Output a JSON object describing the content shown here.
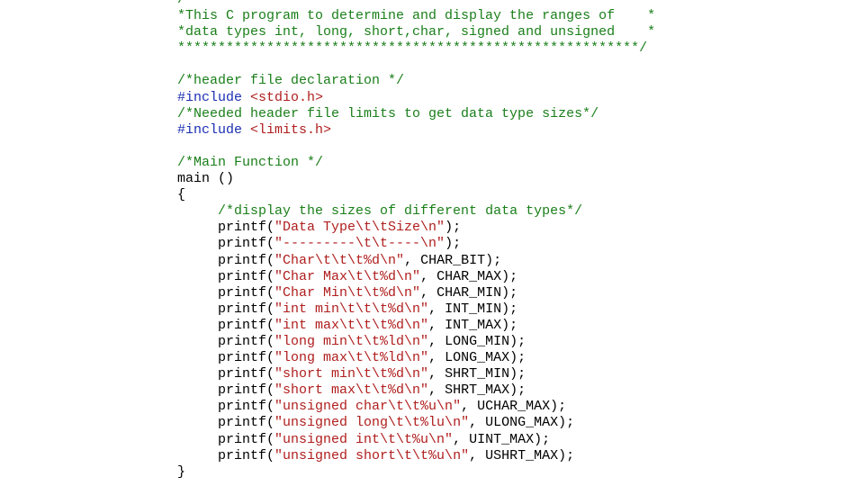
{
  "colors": {
    "background": "#ffffff",
    "comment": "#1a7f1a",
    "directive": "#1c2fb3",
    "string": "#b01e1e",
    "plain": "#000000"
  },
  "code_lines": [
    [
      {
        "t": "comment",
        "v": "/*******************************************************"
      }
    ],
    [
      {
        "t": "comment",
        "v": "*This C program to determine and display the ranges of    *"
      }
    ],
    [
      {
        "t": "comment",
        "v": "*data types int, long, short,char, signed and unsigned    *"
      }
    ],
    [
      {
        "t": "comment",
        "v": "*********************************************************/"
      }
    ],
    [],
    [
      {
        "t": "comment",
        "v": "/*header file declaration */"
      }
    ],
    [
      {
        "t": "directive",
        "v": "#include "
      },
      {
        "t": "header",
        "v": "<stdio.h>"
      }
    ],
    [
      {
        "t": "comment",
        "v": "/*Needed header file limits to get data type sizes*/"
      }
    ],
    [
      {
        "t": "directive",
        "v": "#include "
      },
      {
        "t": "header",
        "v": "<limits.h>"
      }
    ],
    [],
    [
      {
        "t": "comment",
        "v": "/*Main Function */"
      }
    ],
    [
      {
        "t": "plain",
        "v": "main ()"
      }
    ],
    [
      {
        "t": "plain",
        "v": "{"
      }
    ],
    [
      {
        "t": "plain",
        "v": "     "
      },
      {
        "t": "comment",
        "v": "/*display the sizes of different data types*/"
      }
    ],
    [
      {
        "t": "plain",
        "v": "     printf("
      },
      {
        "t": "string",
        "v": "\"Data Type\\t\\tSize\\n\""
      },
      {
        "t": "plain",
        "v": ");"
      }
    ],
    [
      {
        "t": "plain",
        "v": "     printf("
      },
      {
        "t": "string",
        "v": "\"---------\\t\\t----\\n\""
      },
      {
        "t": "plain",
        "v": ");"
      }
    ],
    [
      {
        "t": "plain",
        "v": "     printf("
      },
      {
        "t": "string",
        "v": "\"Char\\t\\t\\t%d\\n\""
      },
      {
        "t": "plain",
        "v": ", CHAR_BIT);"
      }
    ],
    [
      {
        "t": "plain",
        "v": "     printf("
      },
      {
        "t": "string",
        "v": "\"Char Max\\t\\t%d\\n\""
      },
      {
        "t": "plain",
        "v": ", CHAR_MAX);"
      }
    ],
    [
      {
        "t": "plain",
        "v": "     printf("
      },
      {
        "t": "string",
        "v": "\"Char Min\\t\\t%d\\n\""
      },
      {
        "t": "plain",
        "v": ", CHAR_MIN);"
      }
    ],
    [
      {
        "t": "plain",
        "v": "     printf("
      },
      {
        "t": "string",
        "v": "\"int min\\t\\t\\t%d\\n\""
      },
      {
        "t": "plain",
        "v": ", INT_MIN);"
      }
    ],
    [
      {
        "t": "plain",
        "v": "     printf("
      },
      {
        "t": "string",
        "v": "\"int max\\t\\t\\t%d\\n\""
      },
      {
        "t": "plain",
        "v": ", INT_MAX);"
      }
    ],
    [
      {
        "t": "plain",
        "v": "     printf("
      },
      {
        "t": "string",
        "v": "\"long min\\t\\t%ld\\n\""
      },
      {
        "t": "plain",
        "v": ", LONG_MIN);"
      }
    ],
    [
      {
        "t": "plain",
        "v": "     printf("
      },
      {
        "t": "string",
        "v": "\"long max\\t\\t%ld\\n\""
      },
      {
        "t": "plain",
        "v": ", LONG_MAX);"
      }
    ],
    [
      {
        "t": "plain",
        "v": "     printf("
      },
      {
        "t": "string",
        "v": "\"short min\\t\\t%d\\n\""
      },
      {
        "t": "plain",
        "v": ", SHRT_MIN);"
      }
    ],
    [
      {
        "t": "plain",
        "v": "     printf("
      },
      {
        "t": "string",
        "v": "\"short max\\t\\t%d\\n\""
      },
      {
        "t": "plain",
        "v": ", SHRT_MAX);"
      }
    ],
    [
      {
        "t": "plain",
        "v": "     printf("
      },
      {
        "t": "string",
        "v": "\"unsigned char\\t\\t%u\\n\""
      },
      {
        "t": "plain",
        "v": ", UCHAR_MAX);"
      }
    ],
    [
      {
        "t": "plain",
        "v": "     printf("
      },
      {
        "t": "string",
        "v": "\"unsigned long\\t\\t%lu\\n\""
      },
      {
        "t": "plain",
        "v": ", ULONG_MAX);"
      }
    ],
    [
      {
        "t": "plain",
        "v": "     printf("
      },
      {
        "t": "string",
        "v": "\"unsigned int\\t\\t%u\\n\""
      },
      {
        "t": "plain",
        "v": ", UINT_MAX);"
      }
    ],
    [
      {
        "t": "plain",
        "v": "     printf("
      },
      {
        "t": "string",
        "v": "\"unsigned short\\t\\t%u\\n\""
      },
      {
        "t": "plain",
        "v": ", USHRT_MAX);"
      }
    ],
    [
      {
        "t": "plain",
        "v": "}"
      }
    ]
  ]
}
